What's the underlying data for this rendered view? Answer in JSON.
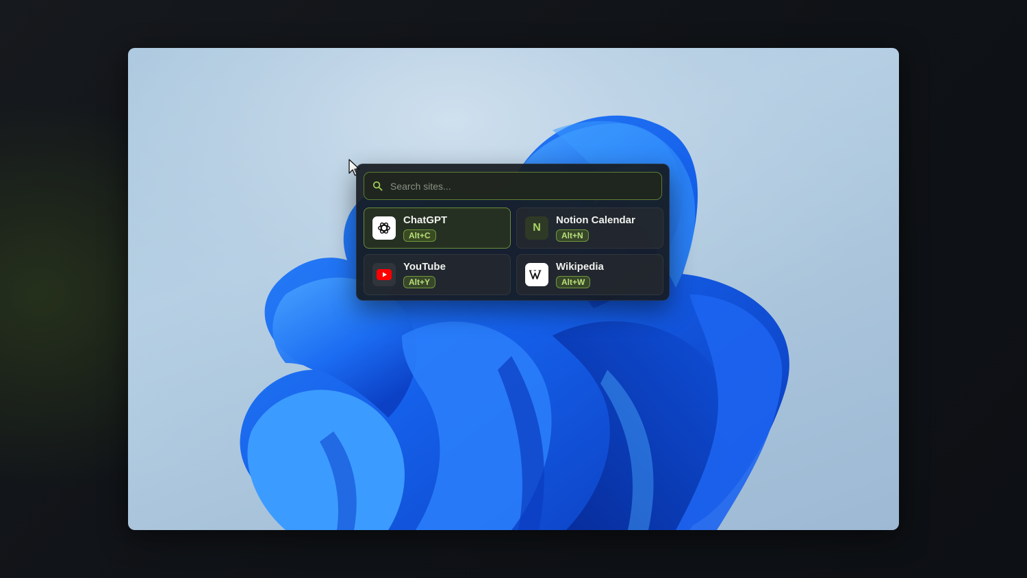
{
  "search": {
    "placeholder": "Search sites..."
  },
  "sites": [
    {
      "name": "ChatGPT",
      "shortcut": "Alt+C",
      "icon": "chatgpt-logo-icon",
      "selected": true
    },
    {
      "name": "Notion Calendar",
      "shortcut": "Alt+N",
      "icon": "notion-calendar-logo-icon",
      "icon_letter": "N",
      "selected": false
    },
    {
      "name": "YouTube",
      "shortcut": "Alt+Y",
      "icon": "youtube-logo-icon",
      "selected": false
    },
    {
      "name": "Wikipedia",
      "shortcut": "Alt+W",
      "icon": "wikipedia-logo-icon",
      "selected": false
    }
  ],
  "colors": {
    "accent": "#8bc34a",
    "panel": "#161a1f",
    "card": "#24292f",
    "youtube_red": "#ff0000",
    "wallpaper_blue": "#1a5ce8"
  }
}
